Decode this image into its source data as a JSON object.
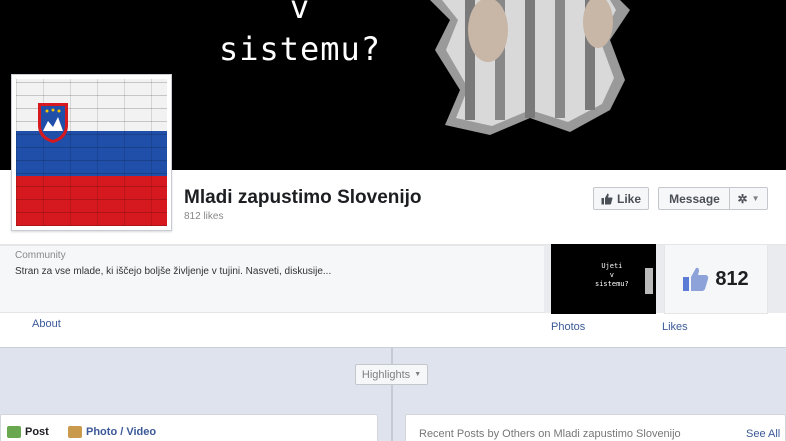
{
  "cover": {
    "text_line1": "v",
    "text_line2": "sistemu?"
  },
  "page": {
    "name": "Mladi zapustimo Slovenijo",
    "likes_label": "812 likes"
  },
  "actions": {
    "like_label": "Like",
    "message_label": "Message"
  },
  "about": {
    "category": "Community",
    "description": "Stran za vse mlade, ki iščejo boljše življenje v tujini. Nasveti, diskusije...",
    "link_label": "About"
  },
  "photos": {
    "thumb_line1": "Ujeti",
    "thumb_line2": "v",
    "thumb_line3": "sistemu?",
    "link_label": "Photos"
  },
  "likes": {
    "count": "812",
    "link_label": "Likes"
  },
  "timeline": {
    "highlights_label": "Highlights",
    "post_tab": "Post",
    "photo_tab": "Photo / Video",
    "recent_title": "Recent Posts by Others on Mladi zapustimo Slovenijo",
    "see_all": "See All"
  },
  "colors": {
    "brand": "#3b5998",
    "flag_white": "#f2f2f2",
    "flag_blue": "#1f4fa8",
    "flag_red": "#d5191e"
  },
  "icons": [
    "thumbs-up-icon",
    "gear-icon",
    "chevron-down-icon",
    "post-icon",
    "photo-icon"
  ]
}
